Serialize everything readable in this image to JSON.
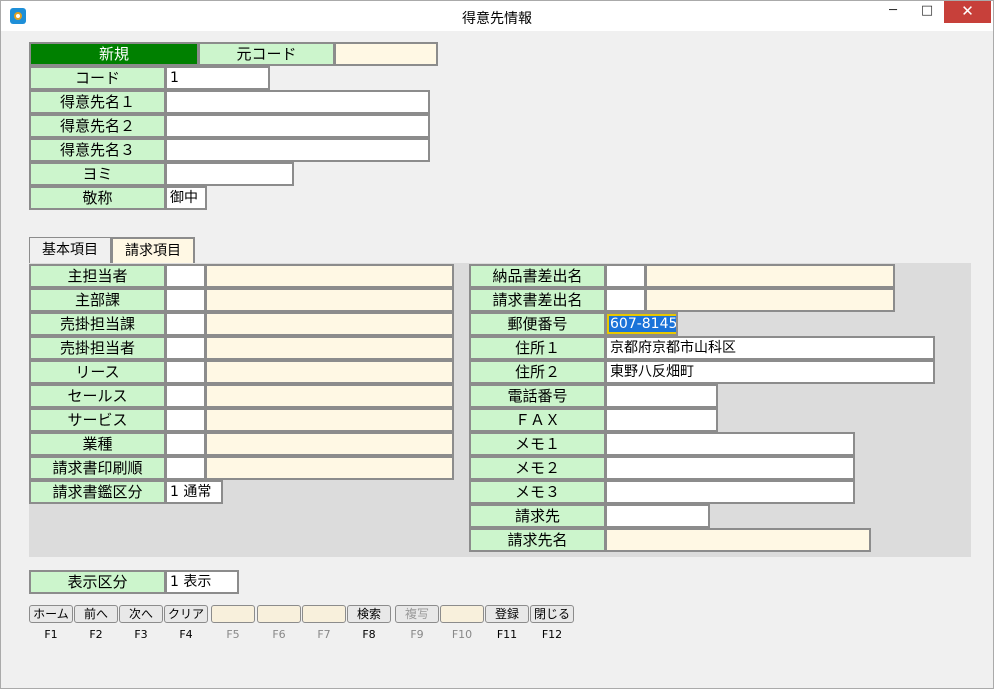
{
  "window": {
    "title": "得意先情報",
    "minimize": "─",
    "maximize": "□",
    "close": "✕"
  },
  "header": {
    "mode": "新規",
    "source_code_label": "元コード",
    "source_code_value": ""
  },
  "basic_fields": [
    {
      "label": "コード",
      "value": "1"
    },
    {
      "label": "得意先名１",
      "value": ""
    },
    {
      "label": "得意先名２",
      "value": ""
    },
    {
      "label": "得意先名３",
      "value": ""
    },
    {
      "label": "ヨミ",
      "value": ""
    },
    {
      "label": "敬称",
      "value": "御中"
    }
  ],
  "tabs": [
    {
      "label": "基本項目",
      "active": false
    },
    {
      "label": "請求項目",
      "active": true
    }
  ],
  "left_fields": [
    {
      "label": "主担当者",
      "code": "",
      "name": ""
    },
    {
      "label": "主部課",
      "code": "",
      "name": ""
    },
    {
      "label": "売掛担当課",
      "code": "",
      "name": ""
    },
    {
      "label": "売掛担当者",
      "code": "",
      "name": ""
    },
    {
      "label": "リース",
      "code": "",
      "name": ""
    },
    {
      "label": "セールス",
      "code": "",
      "name": ""
    },
    {
      "label": "サービス",
      "code": "",
      "name": ""
    },
    {
      "label": "業種",
      "code": "",
      "name": ""
    },
    {
      "label": "請求書印刷順",
      "code": "",
      "name": ""
    },
    {
      "label": "請求書鑑区分",
      "value": "1 通常"
    }
  ],
  "right_fields": [
    {
      "label": "納品書差出名",
      "code": "",
      "name": ""
    },
    {
      "label": "請求書差出名",
      "code": "",
      "name": ""
    },
    {
      "label": "郵便番号",
      "value": "607-8145"
    },
    {
      "label": "住所１",
      "value": "京都府京都市山科区"
    },
    {
      "label": "住所２",
      "value": "東野八反畑町"
    },
    {
      "label": "電話番号",
      "value": ""
    },
    {
      "label": "ＦＡＸ",
      "value": ""
    },
    {
      "label": "メモ１",
      "value": ""
    },
    {
      "label": "メモ２",
      "value": ""
    },
    {
      "label": "メモ３",
      "value": ""
    },
    {
      "label": "請求先",
      "value": ""
    },
    {
      "label": "請求先名",
      "value": ""
    }
  ],
  "display": {
    "label": "表示区分",
    "value": "1 表示"
  },
  "function_keys": [
    {
      "label": "ホーム",
      "key": "F1",
      "enabled": true
    },
    {
      "label": "前へ",
      "key": "F2",
      "enabled": true
    },
    {
      "label": "次へ",
      "key": "F3",
      "enabled": true
    },
    {
      "label": "クリア",
      "key": "F4",
      "enabled": true
    },
    {
      "label": "",
      "key": "F5",
      "enabled": false
    },
    {
      "label": "",
      "key": "F6",
      "enabled": false
    },
    {
      "label": "",
      "key": "F7",
      "enabled": false
    },
    {
      "label": "検索",
      "key": "F8",
      "enabled": true
    },
    {
      "label": "複写",
      "key": "F9",
      "enabled": false
    },
    {
      "label": "",
      "key": "F10",
      "enabled": false
    },
    {
      "label": "登録",
      "key": "F11",
      "enabled": true
    },
    {
      "label": "閉じる",
      "key": "F12",
      "enabled": true
    }
  ]
}
